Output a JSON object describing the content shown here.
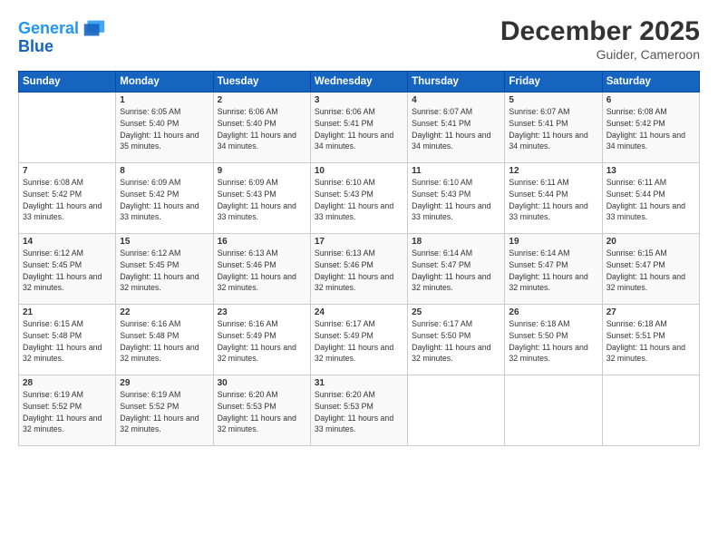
{
  "header": {
    "logo_line1": "General",
    "logo_line2": "Blue",
    "title": "December 2025",
    "location": "Guider, Cameroon"
  },
  "days_of_week": [
    "Sunday",
    "Monday",
    "Tuesday",
    "Wednesday",
    "Thursday",
    "Friday",
    "Saturday"
  ],
  "weeks": [
    [
      {
        "day": "",
        "info": ""
      },
      {
        "day": "1",
        "info": "Sunrise: 6:05 AM\nSunset: 5:40 PM\nDaylight: 11 hours and 35 minutes."
      },
      {
        "day": "2",
        "info": "Sunrise: 6:06 AM\nSunset: 5:40 PM\nDaylight: 11 hours and 34 minutes."
      },
      {
        "day": "3",
        "info": "Sunrise: 6:06 AM\nSunset: 5:41 PM\nDaylight: 11 hours and 34 minutes."
      },
      {
        "day": "4",
        "info": "Sunrise: 6:07 AM\nSunset: 5:41 PM\nDaylight: 11 hours and 34 minutes."
      },
      {
        "day": "5",
        "info": "Sunrise: 6:07 AM\nSunset: 5:41 PM\nDaylight: 11 hours and 34 minutes."
      },
      {
        "day": "6",
        "info": "Sunrise: 6:08 AM\nSunset: 5:42 PM\nDaylight: 11 hours and 34 minutes."
      }
    ],
    [
      {
        "day": "7",
        "info": "Sunrise: 6:08 AM\nSunset: 5:42 PM\nDaylight: 11 hours and 33 minutes."
      },
      {
        "day": "8",
        "info": "Sunrise: 6:09 AM\nSunset: 5:42 PM\nDaylight: 11 hours and 33 minutes."
      },
      {
        "day": "9",
        "info": "Sunrise: 6:09 AM\nSunset: 5:43 PM\nDaylight: 11 hours and 33 minutes."
      },
      {
        "day": "10",
        "info": "Sunrise: 6:10 AM\nSunset: 5:43 PM\nDaylight: 11 hours and 33 minutes."
      },
      {
        "day": "11",
        "info": "Sunrise: 6:10 AM\nSunset: 5:43 PM\nDaylight: 11 hours and 33 minutes."
      },
      {
        "day": "12",
        "info": "Sunrise: 6:11 AM\nSunset: 5:44 PM\nDaylight: 11 hours and 33 minutes."
      },
      {
        "day": "13",
        "info": "Sunrise: 6:11 AM\nSunset: 5:44 PM\nDaylight: 11 hours and 33 minutes."
      }
    ],
    [
      {
        "day": "14",
        "info": "Sunrise: 6:12 AM\nSunset: 5:45 PM\nDaylight: 11 hours and 32 minutes."
      },
      {
        "day": "15",
        "info": "Sunrise: 6:12 AM\nSunset: 5:45 PM\nDaylight: 11 hours and 32 minutes."
      },
      {
        "day": "16",
        "info": "Sunrise: 6:13 AM\nSunset: 5:46 PM\nDaylight: 11 hours and 32 minutes."
      },
      {
        "day": "17",
        "info": "Sunrise: 6:13 AM\nSunset: 5:46 PM\nDaylight: 11 hours and 32 minutes."
      },
      {
        "day": "18",
        "info": "Sunrise: 6:14 AM\nSunset: 5:47 PM\nDaylight: 11 hours and 32 minutes."
      },
      {
        "day": "19",
        "info": "Sunrise: 6:14 AM\nSunset: 5:47 PM\nDaylight: 11 hours and 32 minutes."
      },
      {
        "day": "20",
        "info": "Sunrise: 6:15 AM\nSunset: 5:47 PM\nDaylight: 11 hours and 32 minutes."
      }
    ],
    [
      {
        "day": "21",
        "info": "Sunrise: 6:15 AM\nSunset: 5:48 PM\nDaylight: 11 hours and 32 minutes."
      },
      {
        "day": "22",
        "info": "Sunrise: 6:16 AM\nSunset: 5:48 PM\nDaylight: 11 hours and 32 minutes."
      },
      {
        "day": "23",
        "info": "Sunrise: 6:16 AM\nSunset: 5:49 PM\nDaylight: 11 hours and 32 minutes."
      },
      {
        "day": "24",
        "info": "Sunrise: 6:17 AM\nSunset: 5:49 PM\nDaylight: 11 hours and 32 minutes."
      },
      {
        "day": "25",
        "info": "Sunrise: 6:17 AM\nSunset: 5:50 PM\nDaylight: 11 hours and 32 minutes."
      },
      {
        "day": "26",
        "info": "Sunrise: 6:18 AM\nSunset: 5:50 PM\nDaylight: 11 hours and 32 minutes."
      },
      {
        "day": "27",
        "info": "Sunrise: 6:18 AM\nSunset: 5:51 PM\nDaylight: 11 hours and 32 minutes."
      }
    ],
    [
      {
        "day": "28",
        "info": "Sunrise: 6:19 AM\nSunset: 5:52 PM\nDaylight: 11 hours and 32 minutes."
      },
      {
        "day": "29",
        "info": "Sunrise: 6:19 AM\nSunset: 5:52 PM\nDaylight: 11 hours and 32 minutes."
      },
      {
        "day": "30",
        "info": "Sunrise: 6:20 AM\nSunset: 5:53 PM\nDaylight: 11 hours and 32 minutes."
      },
      {
        "day": "31",
        "info": "Sunrise: 6:20 AM\nSunset: 5:53 PM\nDaylight: 11 hours and 33 minutes."
      },
      {
        "day": "",
        "info": ""
      },
      {
        "day": "",
        "info": ""
      },
      {
        "day": "",
        "info": ""
      }
    ]
  ]
}
